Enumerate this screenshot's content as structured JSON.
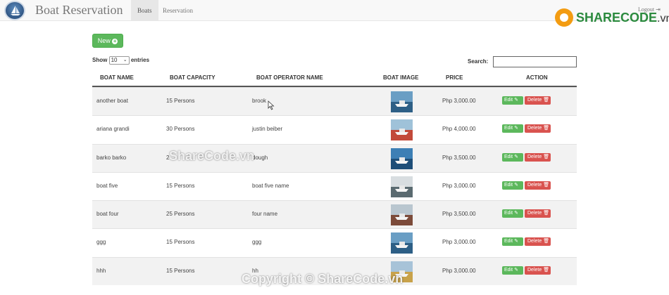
{
  "app": {
    "brand": "Boat Reservation",
    "tabs": [
      "Boats",
      "Reservation"
    ],
    "logout": "Logout"
  },
  "watermark": {
    "logo_main": "SHARECODE",
    "logo_suffix": ".vn",
    "middle": "ShareCode.vn",
    "bottom": "Copyright © ShareCode.vn"
  },
  "toolbar": {
    "new_label": "New"
  },
  "entries": {
    "show_label": "Show",
    "selected": "10",
    "entries_label": "entries"
  },
  "search": {
    "label": "Search:",
    "value": ""
  },
  "table": {
    "headers": [
      "BOAT NAME",
      "BOAT CAPACITY",
      "BOAT OPERATOR NAME",
      "BOAT IMAGE",
      "PRICE",
      "ACTION"
    ],
    "edit_label": "Edit",
    "delete_label": "Delete",
    "rows": [
      {
        "name": "another boat",
        "capacity": "15 Persons",
        "operator": "brook",
        "price": "Php 3,000.00",
        "img_top": "#6a9ec4",
        "img_bottom": "#2d5f86"
      },
      {
        "name": "ariana grandi",
        "capacity": "30 Persons",
        "operator": "justin beiber",
        "price": "Php 4,000.00",
        "img_top": "#9fc2d9",
        "img_bottom": "#c24a3a"
      },
      {
        "name": "barko barko",
        "capacity": "2",
        "operator": "dough",
        "price": "Php 3,500.00",
        "img_top": "#3d7fb5",
        "img_bottom": "#1e4e78"
      },
      {
        "name": "boat five",
        "capacity": "15 Persons",
        "operator": "boat five name",
        "price": "Php 3,000.00",
        "img_top": "#d8dde0",
        "img_bottom": "#5a6a70"
      },
      {
        "name": "boat four",
        "capacity": "25 Persons",
        "operator": "four name",
        "price": "Php 3,500.00",
        "img_top": "#b9c6cf",
        "img_bottom": "#7c4b3a"
      },
      {
        "name": "ggg",
        "capacity": "15 Persons",
        "operator": "ggg",
        "price": "Php 3,000.00",
        "img_top": "#6a9ec4",
        "img_bottom": "#2d5f86"
      },
      {
        "name": "hhh",
        "capacity": "15 Persons",
        "operator": "hh",
        "price": "Php 3,000.00",
        "img_top": "#a7c3d8",
        "img_bottom": "#c8a24a"
      }
    ]
  },
  "colors": {
    "success": "#5cb85c",
    "danger": "#d9534f",
    "navbar": "#f8f8f8"
  }
}
